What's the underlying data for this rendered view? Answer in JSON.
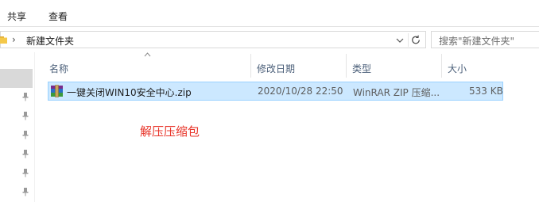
{
  "ribbon": {
    "tabs": [
      "共享",
      "查看"
    ]
  },
  "address": {
    "separator": "›",
    "current_folder": "新建文件夹"
  },
  "search": {
    "placeholder": "搜索\"新建文件夹\""
  },
  "columns": {
    "name": "名称",
    "date_modified": "修改日期",
    "type": "类型",
    "size": "大小",
    "sort_indicator": "ascending"
  },
  "files": [
    {
      "name": "一键关闭WIN10安全中心.zip",
      "date_modified": "2020/10/28 22:50",
      "type": "WinRAR ZIP 压缩...",
      "size": "533 KB",
      "icon": "winrar-archive-icon",
      "selected": true
    }
  ],
  "annotation": {
    "text": "解压压缩包",
    "color": "#e8352a"
  },
  "colors": {
    "selection_fill": "#cce8ff",
    "selection_border": "#99d1ff",
    "header_text": "#4c607a",
    "folder_yellow": "#f4c84a"
  }
}
